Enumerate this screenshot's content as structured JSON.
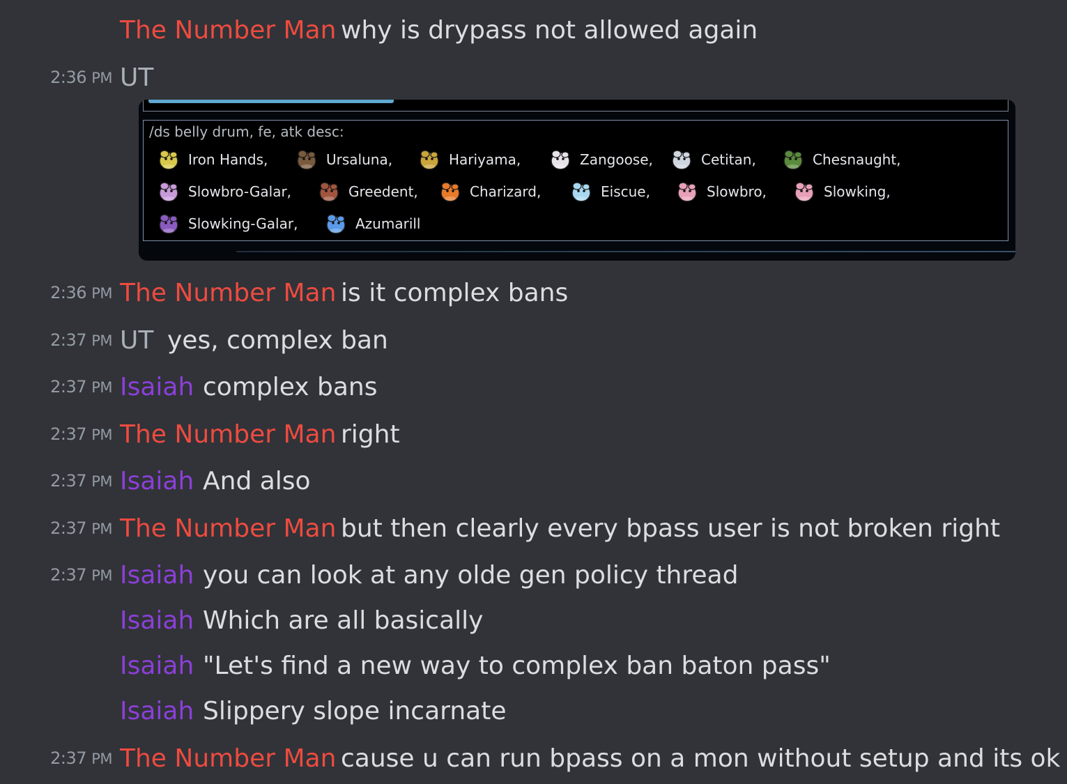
{
  "users": {
    "number_man": "The Number Man",
    "ut": "UT",
    "isaiah": "Isaiah"
  },
  "colors": {
    "background": "#313338",
    "number_man": "#ee4b40",
    "ut": "#aab0b8",
    "isaiah": "#8c3fd9",
    "message_text": "#dbdee1",
    "timestamp": "#949ba4"
  },
  "messages": [
    {
      "time": "",
      "ampm": "",
      "author": "The Number Man",
      "text": "why is drypass not allowed again"
    },
    {
      "time": "2:36",
      "ampm": "PM",
      "author": "UT",
      "text": ""
    },
    {
      "time": "2:36",
      "ampm": "PM",
      "author": "The Number Man",
      "text": "is it complex bans"
    },
    {
      "time": "2:37",
      "ampm": "PM",
      "author": "UT",
      "text": "yes, complex ban"
    },
    {
      "time": "2:37",
      "ampm": "PM",
      "author": "Isaiah",
      "text": "complex bans"
    },
    {
      "time": "2:37",
      "ampm": "PM",
      "author": "The Number Man",
      "text": "right"
    },
    {
      "time": "2:37",
      "ampm": "PM",
      "author": "Isaiah",
      "text": "And also"
    },
    {
      "time": "2:37",
      "ampm": "PM",
      "author": "The Number Man",
      "text": "but then clearly every bpass user is not broken right"
    },
    {
      "time": "2:37",
      "ampm": "PM",
      "author": "Isaiah",
      "text": "you can look at any olde gen policy thread"
    },
    {
      "time": "",
      "ampm": "",
      "author": "Isaiah",
      "text": "Which are all basically"
    },
    {
      "time": "",
      "ampm": "",
      "author": "Isaiah",
      "text": "\"Let's find a new way to complex ban baton pass\""
    },
    {
      "time": "",
      "ampm": "",
      "author": "Isaiah",
      "text": "Slippery slope incarnate"
    },
    {
      "time": "2:37",
      "ampm": "PM",
      "author": "The Number Man",
      "text": "cause u can run bpass on a mon without setup and its ok"
    }
  ],
  "embed": {
    "command": "/ds belly drum, fe, atk desc:",
    "results": [
      {
        "name": "Iron Hands,",
        "icon": "iron-hands-icon",
        "color": "#d8c84a"
      },
      {
        "name": "Ursaluna,",
        "icon": "ursaluna-icon",
        "color": "#7a5a3e"
      },
      {
        "name": "Hariyama,",
        "icon": "hariyama-icon",
        "color": "#c9a53a"
      },
      {
        "name": "Zangoose,",
        "icon": "zangoose-icon",
        "color": "#e8e3e8"
      },
      {
        "name": "Cetitan,",
        "icon": "cetitan-icon",
        "color": "#cfd6e0"
      },
      {
        "name": "Chesnaught,",
        "icon": "chesnaught-icon",
        "color": "#5a8a3c"
      },
      {
        "name": "Slowbro-Galar,",
        "icon": "slowbro-galar-icon",
        "color": "#c79ad8"
      },
      {
        "name": "Greedent,",
        "icon": "greedent-icon",
        "color": "#a2553e"
      },
      {
        "name": "Charizard,",
        "icon": "charizard-icon",
        "color": "#e87a2a"
      },
      {
        "name": "Eiscue,",
        "icon": "eiscue-icon",
        "color": "#a8d8f0"
      },
      {
        "name": "Slowbro,",
        "icon": "slowbro-icon",
        "color": "#e8a0b8"
      },
      {
        "name": "Slowking,",
        "icon": "slowking-icon",
        "color": "#e8a0b8"
      },
      {
        "name": "Slowking-Galar,",
        "icon": "slowking-galar-icon",
        "color": "#8a5ac0"
      },
      {
        "name": "Azumarill",
        "icon": "azumarill-icon",
        "color": "#5a9ae8"
      }
    ]
  }
}
